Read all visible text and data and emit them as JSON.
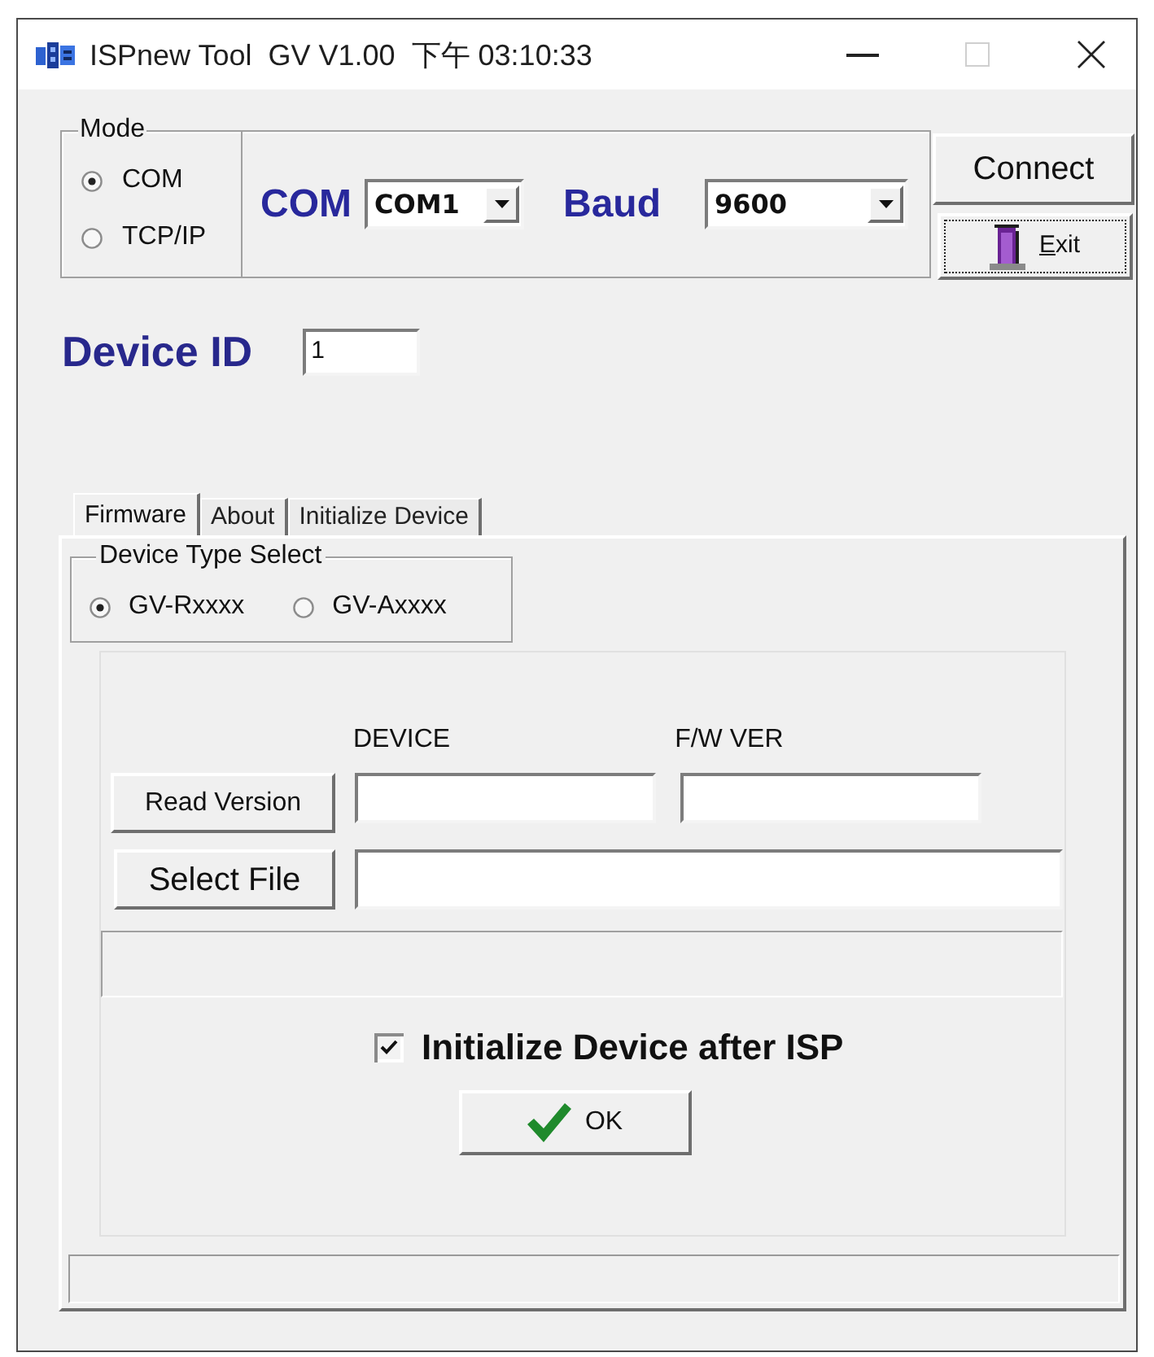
{
  "window": {
    "title": "ISPnew Tool  GV V1.00  下午 03:10:33",
    "maximize_disabled": true
  },
  "mode": {
    "label": "Mode",
    "options": [
      {
        "label": "COM",
        "selected": true
      },
      {
        "label": "TCP/IP",
        "selected": false
      }
    ]
  },
  "connection": {
    "com_label": "COM",
    "com_value": "COM1",
    "baud_label": "Baud",
    "baud_value": "9600"
  },
  "connect_button": {
    "label": "Connect"
  },
  "exit_button": {
    "label": "Exit",
    "mnemonic_underlined": true,
    "focused": true
  },
  "device_id": {
    "label": "Device ID",
    "value": "1"
  },
  "tabs": [
    {
      "label": "Firmware",
      "selected": true
    },
    {
      "label": "About",
      "selected": false
    },
    {
      "label": "Initialize Device",
      "selected": false
    }
  ],
  "device_type": {
    "label": "Device Type Select",
    "options": [
      {
        "label": "GV-Rxxxx",
        "selected": true
      },
      {
        "label": "GV-Axxxx",
        "selected": false
      }
    ]
  },
  "version": {
    "device_label": "DEVICE",
    "fw_label": "F/W VER",
    "read_button": "Read Version"
  },
  "file": {
    "select_button": "Select File"
  },
  "initialize_after_isp": {
    "label": "Initialize Device after ISP",
    "checked": true
  },
  "ok_button": {
    "label": "OK"
  }
}
